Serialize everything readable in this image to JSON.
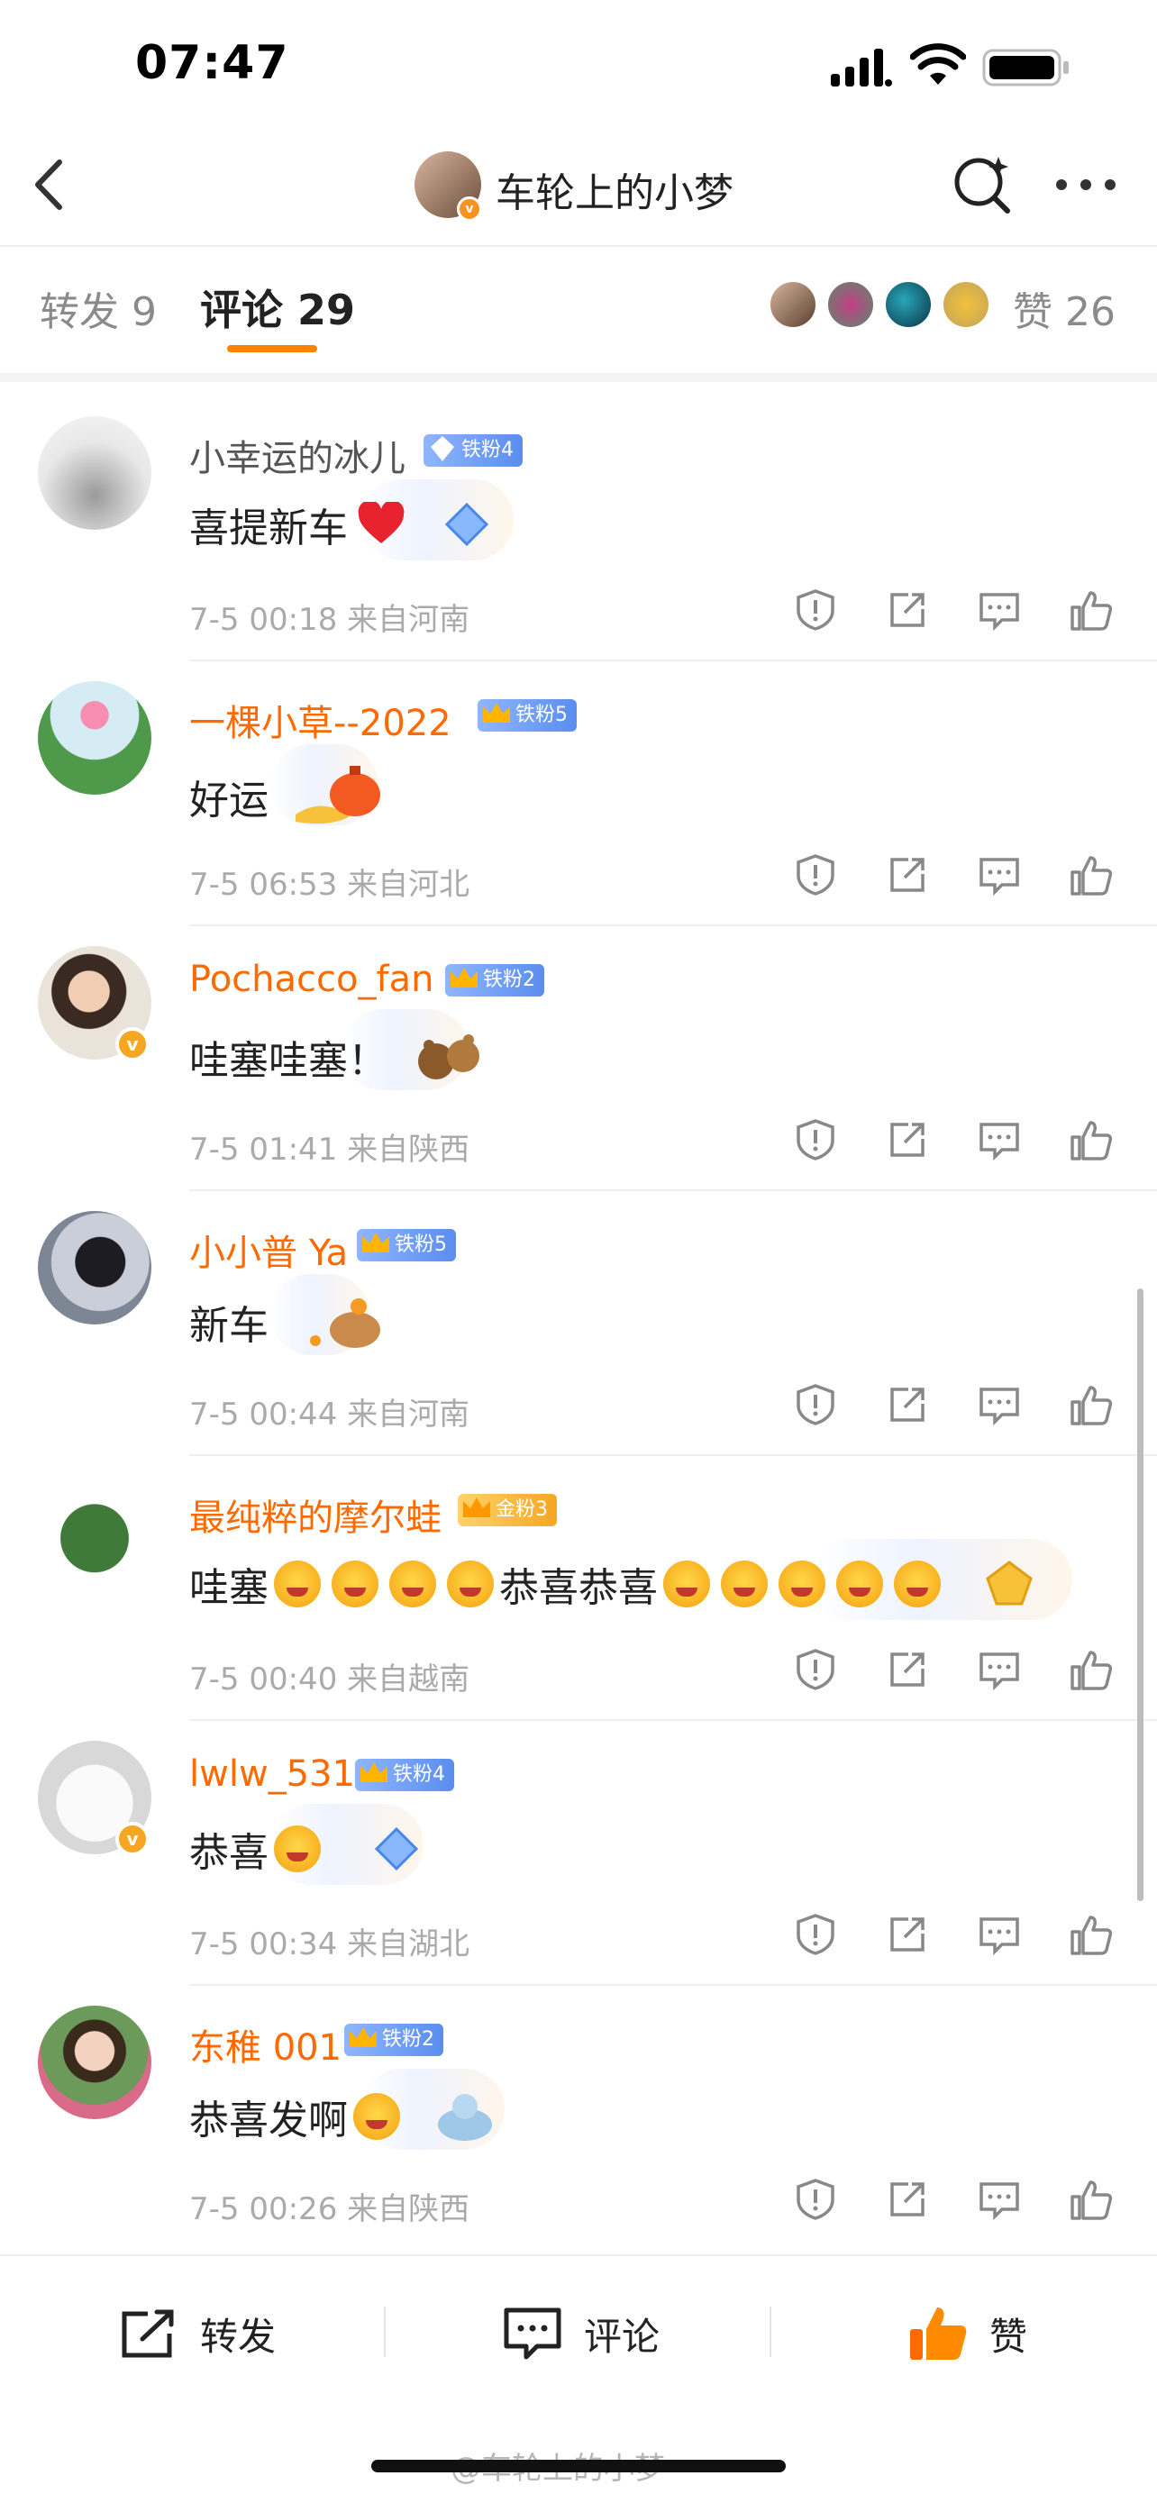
{
  "status_bar": {
    "time": "07:47"
  },
  "header": {
    "title": "车轮上的小梦"
  },
  "tabs": {
    "repost": "转发 9",
    "comment": "评论 29",
    "like": "赞 26"
  },
  "comments": [
    {
      "username": "小幸运的冰儿",
      "fan_badge": "铁粉4",
      "text": "喜提新车",
      "meta": "7-5 00:18  来自河南",
      "name_color": "gray"
    },
    {
      "username": "一棵小草--2022",
      "fan_badge": "铁粉5",
      "text": "好运",
      "meta": "7-5 06:53  来自河北",
      "name_color": "orange"
    },
    {
      "username": "Pochacco_fan",
      "fan_badge": "铁粉2",
      "text": "哇塞哇塞！",
      "meta": "7-5 01:41  来自陕西",
      "name_color": "orange"
    },
    {
      "username": "小小普 Ya",
      "fan_badge": "铁粉5",
      "text": "新车",
      "meta": "7-5 00:44  来自河南",
      "name_color": "orange"
    },
    {
      "username": "最纯粹的摩尔蛙",
      "fan_badge": "金粉3",
      "text_a": "哇塞",
      "text_b": "恭喜恭喜",
      "meta": "7-5 00:40  来自越南",
      "name_color": "orange"
    },
    {
      "username": "lwlw_531",
      "fan_badge": "铁粉4",
      "text": "恭喜",
      "meta": "7-5 00:34  来自湖北",
      "name_color": "orange"
    },
    {
      "username": "东稚 001",
      "fan_badge": "铁粉2",
      "text": "恭喜发啊",
      "meta": "7-5 00:26  来自陕西",
      "name_color": "orange"
    }
  ],
  "bottom_bar": {
    "repost": "转发",
    "comment": "评论",
    "like": "赞"
  },
  "watermark": "@车轮上的小梦",
  "colors": {
    "accent": "#ff8200",
    "name_orange": "#ff6a00",
    "iron_fan": "#5a8dee",
    "gold_fan": "#f5a623"
  }
}
